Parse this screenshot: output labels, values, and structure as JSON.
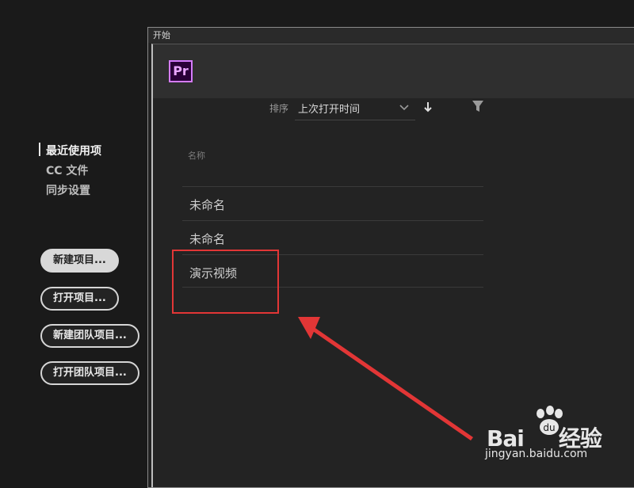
{
  "window": {
    "title": "开始"
  },
  "header": {
    "logo_text": "Pr"
  },
  "sort": {
    "label": "排序",
    "selected": "上次打开时间"
  },
  "sidebar": {
    "items": [
      {
        "label": "最近使用项",
        "active": true
      },
      {
        "label": "CC 文件",
        "active": false
      },
      {
        "label": "同步设置",
        "active": false
      }
    ]
  },
  "buttons": {
    "new_project": "新建项目...",
    "open_project": "打开项目...",
    "new_team_project": "新建团队项目...",
    "open_team_project": "打开团队项目..."
  },
  "recent": {
    "column_header": "名称",
    "rows": [
      {
        "name": "未命名"
      },
      {
        "name": "未命名"
      },
      {
        "name": "演示视频"
      }
    ]
  },
  "annotation": {
    "color": "#e23636"
  },
  "watermark": {
    "brand_prefix": "Bai",
    "brand_suffix": "经验",
    "site": "jingyan.baidu.com"
  },
  "colors": {
    "accent": "#d57bff",
    "background": "#232323"
  }
}
